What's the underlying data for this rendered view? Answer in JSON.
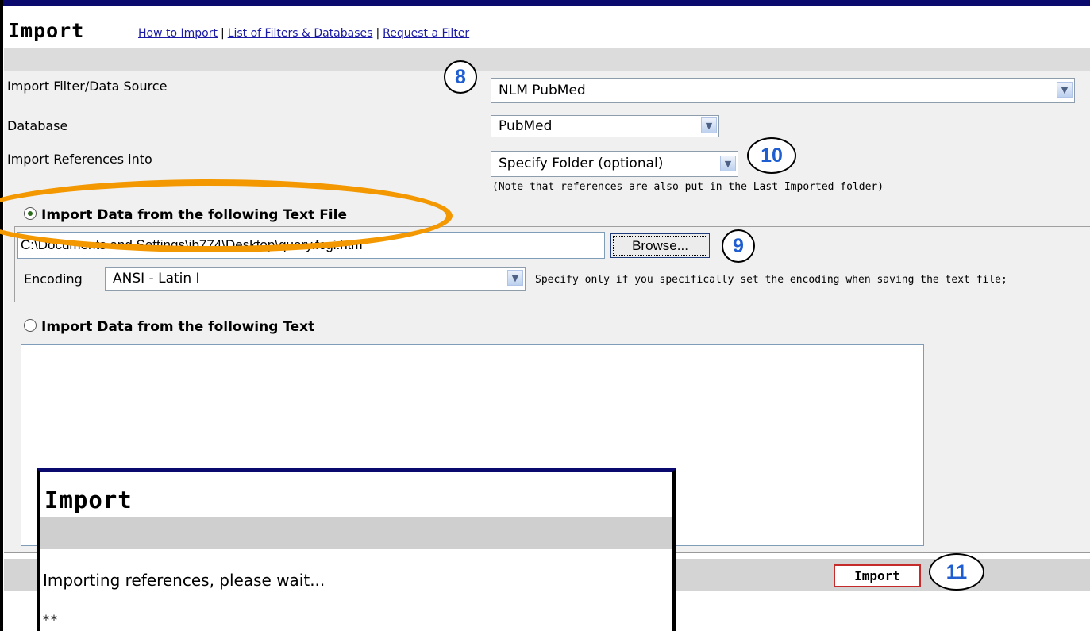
{
  "header": {
    "title": "Import",
    "links": [
      "How to Import",
      "List of Filters & Databases",
      "Request a Filter"
    ],
    "separator": "|"
  },
  "form": {
    "filter_label": "Import Filter/Data Source",
    "filter_value": "NLM PubMed",
    "database_label": "Database",
    "database_value": "PubMed",
    "folder_label": "Import References into",
    "folder_value": "Specify Folder (optional)",
    "folder_note": "(Note that references are also put in the Last Imported folder)"
  },
  "file_option": {
    "label": "Import Data from the following Text File",
    "selected": true,
    "path_value": "C:\\Documents and Settings\\jb774\\Desktop\\query.fcgi.htm",
    "browse_label": "Browse...",
    "encoding_label": "Encoding",
    "encoding_value": "ANSI - Latin I",
    "encoding_hint": "Specify only if you specifically set the encoding when saving the text file;"
  },
  "text_option": {
    "label": "Import Data from the following Text",
    "selected": false,
    "text_value": ""
  },
  "footer": {
    "import_label": "Import"
  },
  "callouts": {
    "c8": "8",
    "c9": "9",
    "c10": "10",
    "c11": "11"
  },
  "overlay": {
    "title": "Import",
    "message": "Importing references, please wait...",
    "progress": "**"
  },
  "colors": {
    "highlight_ellipse": "#f39800",
    "callout_text": "#1f5ed0",
    "import_border": "#c62b2b"
  }
}
